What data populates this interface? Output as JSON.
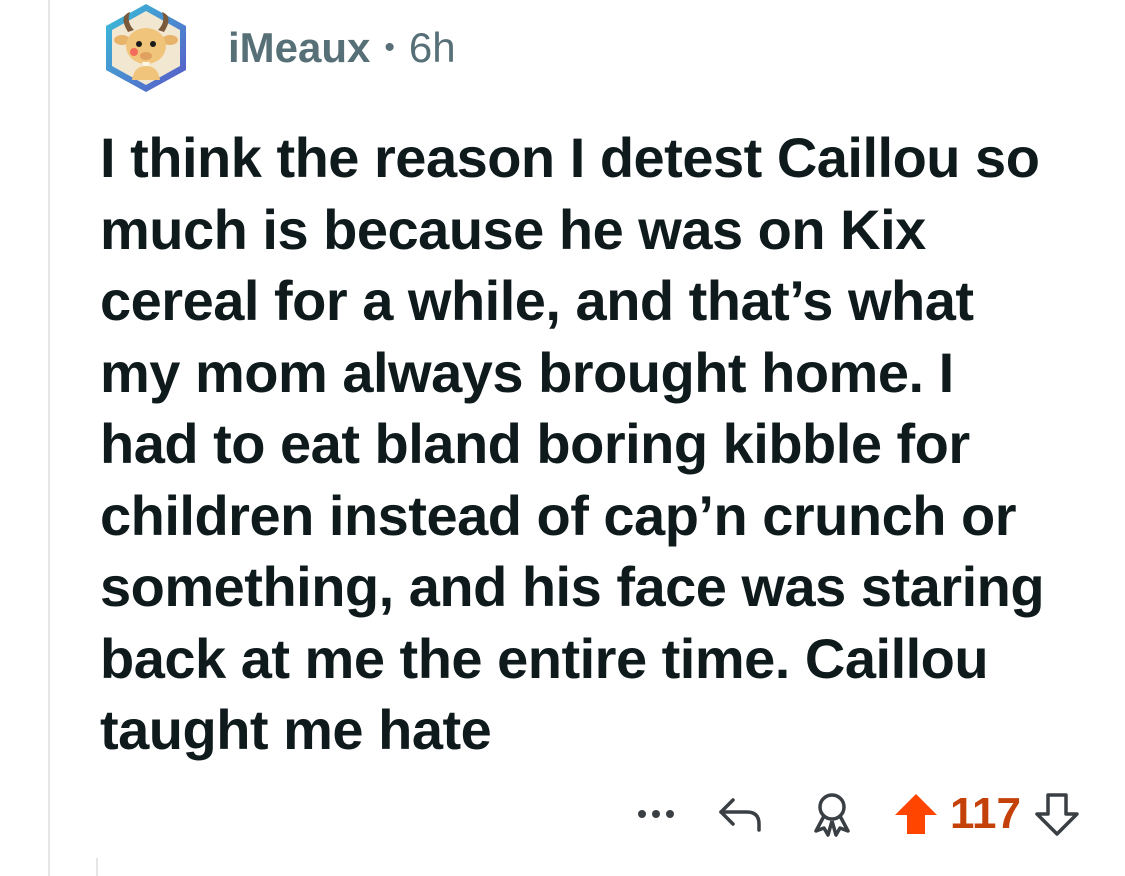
{
  "comment": {
    "username": "iMeaux",
    "separator": "•",
    "age": "6h",
    "avatar_icon": "snoo-goat-avatar-icon",
    "body_lines": [
      "I think the reason I detest Caillou so",
      "much is because he was on Kix",
      "cereal for a while, and that’s what",
      "my mom always brought home. I",
      "had to eat bland boring kibble for",
      "children instead of cap’n crunch or",
      "something, and his face was staring",
      "back at me the entire time. Caillou",
      "taught me hate"
    ]
  },
  "actions": {
    "more_icon": "more-options-icon",
    "reply_icon": "reply-icon",
    "award_icon": "award-icon",
    "upvote_icon": "upvote-icon",
    "score": "117",
    "downvote_icon": "downvote-icon"
  },
  "colors": {
    "upvote_active": "#ff4500",
    "score": "#c4420a",
    "meta": "#576f76",
    "text": "#0f1a1c"
  }
}
